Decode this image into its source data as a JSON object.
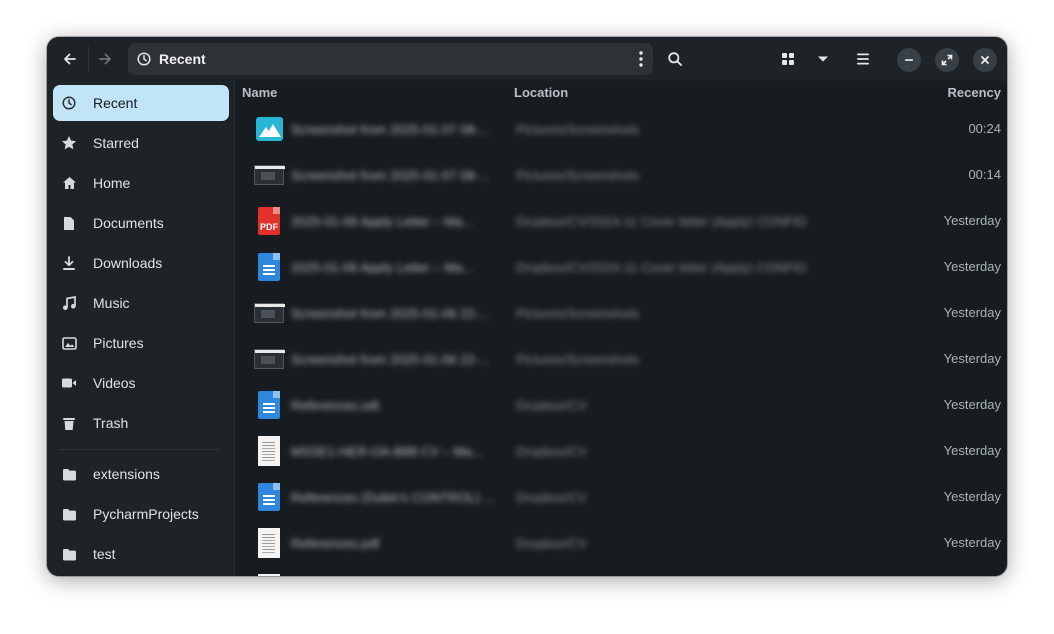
{
  "header": {
    "back_icon": "arrow-left-icon",
    "forward_icon": "arrow-right-icon",
    "location_title": "Recent",
    "location_icon": "clock-icon",
    "menu_icon": "kebab-menu-icon",
    "search_icon": "search-icon",
    "grid_view_icon": "grid-icon",
    "sort_icon": "chevron-down-icon",
    "list_menu_icon": "hamburger-menu-icon",
    "minimize_icon": "minimize-icon",
    "maximize_icon": "maximize-icon",
    "close_icon": "close-icon"
  },
  "sidebar": {
    "places": [
      {
        "label": "Recent",
        "icon": "clock-icon",
        "active": true
      },
      {
        "label": "Starred",
        "icon": "star-icon"
      },
      {
        "label": "Home",
        "icon": "home-icon"
      },
      {
        "label": "Documents",
        "icon": "document-icon"
      },
      {
        "label": "Downloads",
        "icon": "download-icon"
      },
      {
        "label": "Music",
        "icon": "music-icon"
      },
      {
        "label": "Pictures",
        "icon": "picture-icon"
      },
      {
        "label": "Videos",
        "icon": "video-icon"
      },
      {
        "label": "Trash",
        "icon": "trash-icon"
      }
    ],
    "bookmarks": [
      {
        "label": "extensions",
        "icon": "folder-icon"
      },
      {
        "label": "PycharmProjects",
        "icon": "folder-icon"
      },
      {
        "label": "test",
        "icon": "folder-icon"
      }
    ]
  },
  "columns": {
    "name": "Name",
    "location": "Location",
    "recency": "Recency"
  },
  "files": [
    {
      "type": "image",
      "name": "Screenshot from 2025-01-07 08-...",
      "location": "Pictures/Screenshots",
      "recency": "00:24"
    },
    {
      "type": "screenshot",
      "name": "Screenshot from 2025-01-07 08-...",
      "location": "Pictures/Screenshots",
      "recency": "00:14"
    },
    {
      "type": "pdf",
      "name": "2025-01-06 Apply Letter – Ma...",
      "location": "Dropbox/CV/2024-11 Cover letter (Apply) CONFIG",
      "recency": "Yesterday"
    },
    {
      "type": "doc",
      "name": "2025-01-06 Apply Letter – Ma...",
      "location": "Dropbox/CV/2024-11 Cover letter (Apply) CONFIG",
      "recency": "Yesterday"
    },
    {
      "type": "screenshot",
      "name": "Screenshot from 2025-01-06 22-...",
      "location": "Pictures/Screenshots",
      "recency": "Yesterday"
    },
    {
      "type": "screenshot",
      "name": "Screenshot from 2025-01-06 22-...",
      "location": "Pictures/Screenshots",
      "recency": "Yesterday"
    },
    {
      "type": "doc",
      "name": "References.odt",
      "location": "Dropbox/CV",
      "recency": "Yesterday"
    },
    {
      "type": "page",
      "name": "MSSE1-HER-OA-B88 CV – Ma...",
      "location": "Dropbox/CV",
      "recency": "Yesterday"
    },
    {
      "type": "doc",
      "name": "References (Dubin's CONTROL) ...",
      "location": "Dropbox/CV",
      "recency": "Yesterday"
    },
    {
      "type": "page",
      "name": "References.pdf",
      "location": "Dropbox/CV",
      "recency": "Yesterday"
    }
  ]
}
